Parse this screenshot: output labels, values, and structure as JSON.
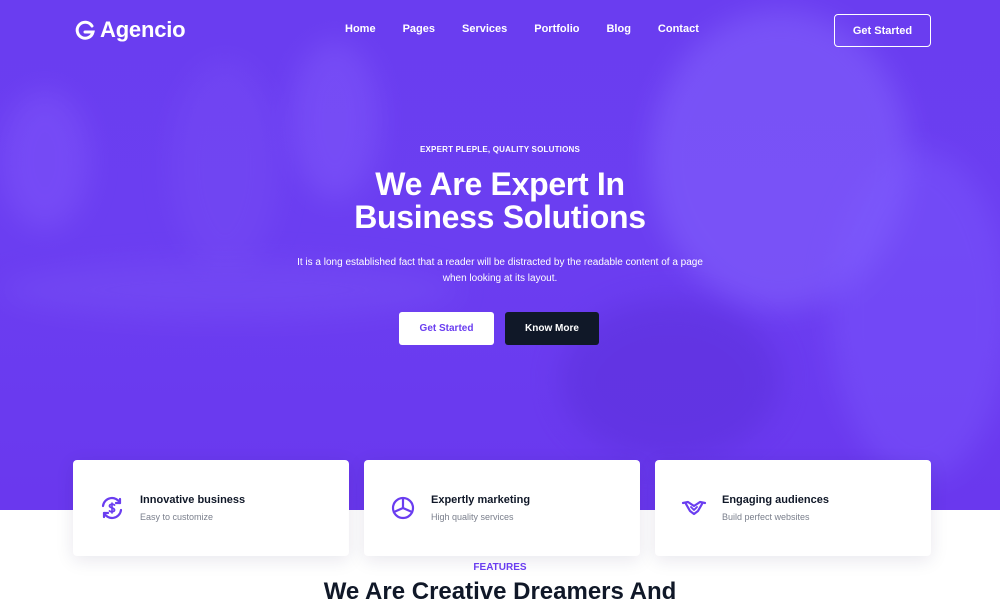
{
  "brand": {
    "name": "Agencio",
    "logo_icon": "g-logo-icon"
  },
  "nav": {
    "items": [
      "Home",
      "Pages",
      "Services",
      "Portfolio",
      "Blog",
      "Contact"
    ],
    "cta": "Get Started"
  },
  "hero": {
    "eyebrow": "EXPERT PLEPLE, QUALITY SOLUTIONS",
    "title_line1": "We Are Expert In",
    "title_line2": "Business Solutions",
    "subtitle_line1": "It is a long established fact that a reader will be distracted by the readable content of a page",
    "subtitle_line2": "when looking at its layout.",
    "primary_button": "Get Started",
    "secondary_button": "Know More"
  },
  "cards": [
    {
      "title": "Innovative business",
      "subtitle": "Easy to customize",
      "icon": "dollar-refresh-icon"
    },
    {
      "title": "Expertly marketing",
      "subtitle": "High quality services",
      "icon": "pie-chart-icon"
    },
    {
      "title": "Engaging audiences",
      "subtitle": "Build perfect websites",
      "icon": "handshake-icon"
    }
  ],
  "section": {
    "label": "FEATURES",
    "title": "We Are Creative Dreamers And"
  },
  "colors": {
    "accent": "#6a3df0",
    "dark": "#101828",
    "muted": "#7a7f8c"
  }
}
